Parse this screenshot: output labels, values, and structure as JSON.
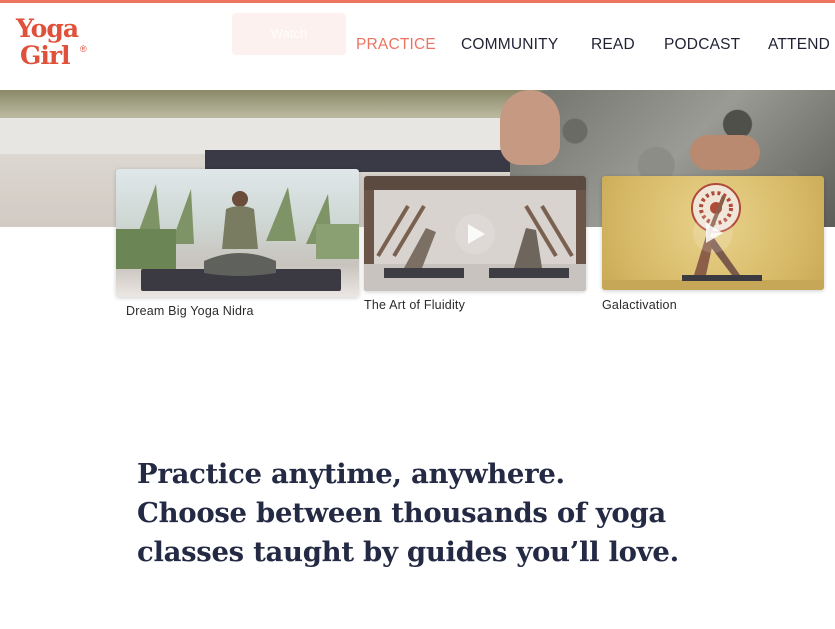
{
  "logo": {
    "line1": "Yoga",
    "line2": "Girl",
    "registered": "®"
  },
  "header": {
    "ghost_button": "Watch"
  },
  "nav": {
    "items": [
      {
        "label": "PRACTICE",
        "active": true
      },
      {
        "label": "COMMUNITY",
        "active": false
      },
      {
        "label": "READ",
        "active": false
      },
      {
        "label": "PODCAST",
        "active": false
      },
      {
        "label": "ATTEND",
        "active": false
      }
    ]
  },
  "videos": [
    {
      "title": "Dream Big Yoga Nidra"
    },
    {
      "title": "The Art of Fluidity"
    },
    {
      "title": "Galactivation"
    }
  ],
  "headline": {
    "line1": "Practice anytime, anywhere.",
    "line2": "Choose between thousands of yoga",
    "line3": "classes taught by guides you’ll love."
  },
  "colors": {
    "accent": "#ee7462",
    "logo": "#e0513b",
    "heading": "#242a44",
    "nav_text": "#1f2233"
  }
}
